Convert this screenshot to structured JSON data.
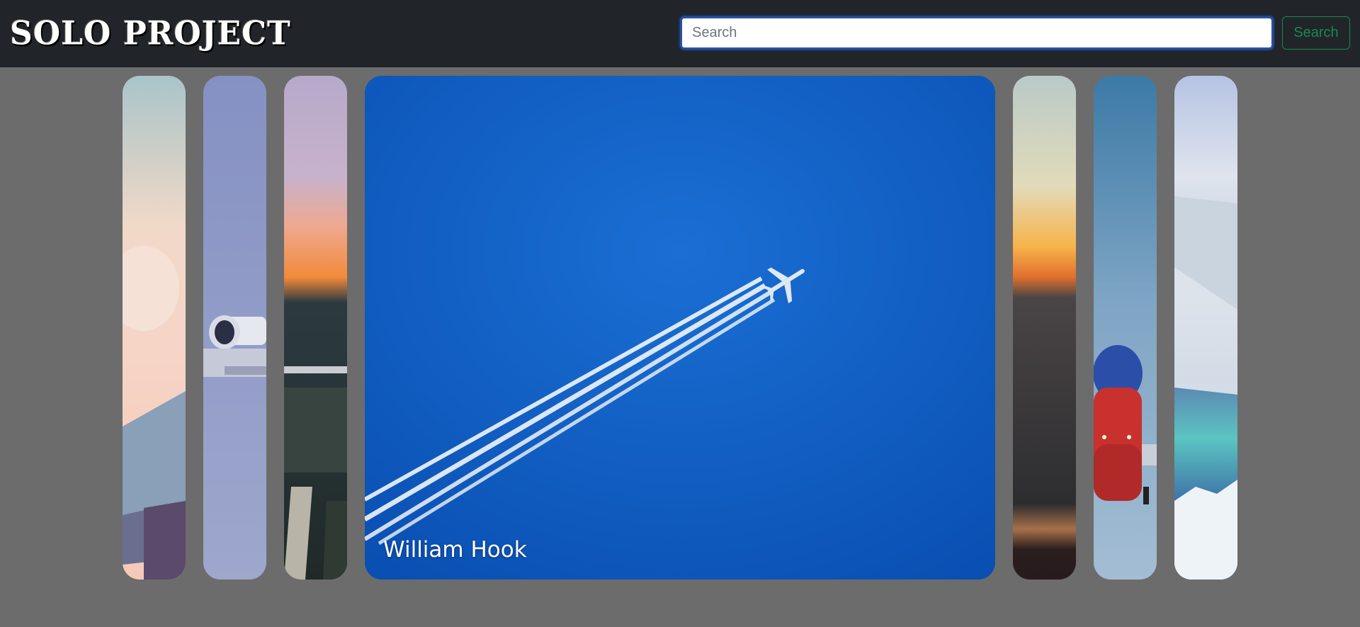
{
  "navbar": {
    "brand": "SOLO PROJECT",
    "search_placeholder": "Search",
    "search_value": "",
    "search_button_label": "Search"
  },
  "gallery": {
    "active_index": 3,
    "active_caption": "William Hook",
    "items": [
      {
        "subject": "airplane-wing-sunset-clouds"
      },
      {
        "subject": "jet-engine-lavender-sky"
      },
      {
        "subject": "airport-sunset-tarmac"
      },
      {
        "subject": "airplane-contrails-blue-sky"
      },
      {
        "subject": "sunset-horizon-aerial"
      },
      {
        "subject": "airplane-front-landing-gear"
      },
      {
        "subject": "wing-over-mountains-lake"
      }
    ]
  },
  "colors": {
    "navbar_bg": "#212529",
    "page_bg": "#6c6c6c",
    "search_button": "#198754",
    "sky_blue": "#0b57c0"
  }
}
